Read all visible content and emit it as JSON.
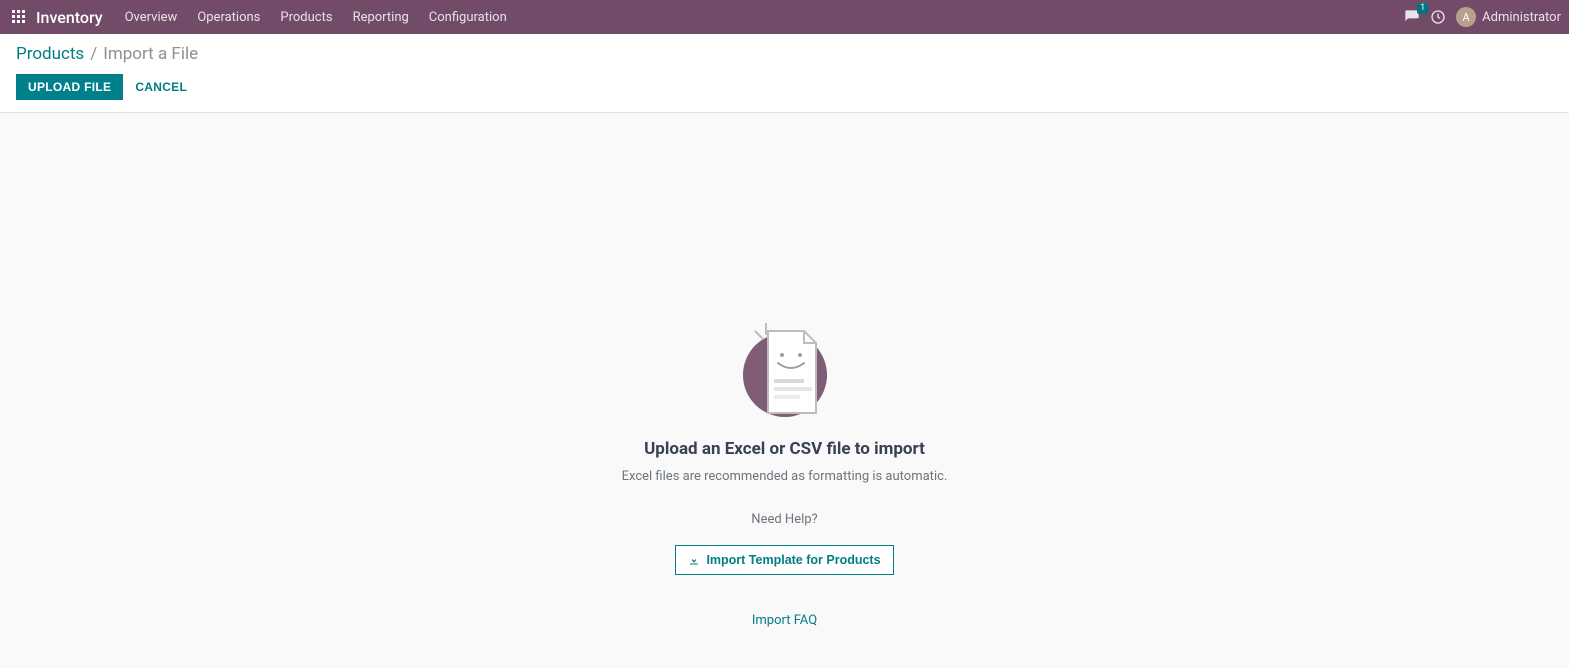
{
  "navbar": {
    "brand": "Inventory",
    "items": [
      {
        "label": "Overview"
      },
      {
        "label": "Operations"
      },
      {
        "label": "Products"
      },
      {
        "label": "Reporting"
      },
      {
        "label": "Configuration"
      }
    ],
    "messaging_badge": "1",
    "user_initial": "A",
    "user_name": "Administrator"
  },
  "breadcrumb": {
    "parent": "Products",
    "separator": "/",
    "current": "Import a File"
  },
  "actions": {
    "upload_label": "UPLOAD FILE",
    "cancel_label": "CANCEL"
  },
  "empty_state": {
    "title": "Upload an Excel or CSV file to import",
    "subtitle": "Excel files are recommended as formatting is automatic.",
    "need_help": "Need Help?",
    "template_button": "Import Template for Products",
    "faq_link": "Import FAQ"
  }
}
